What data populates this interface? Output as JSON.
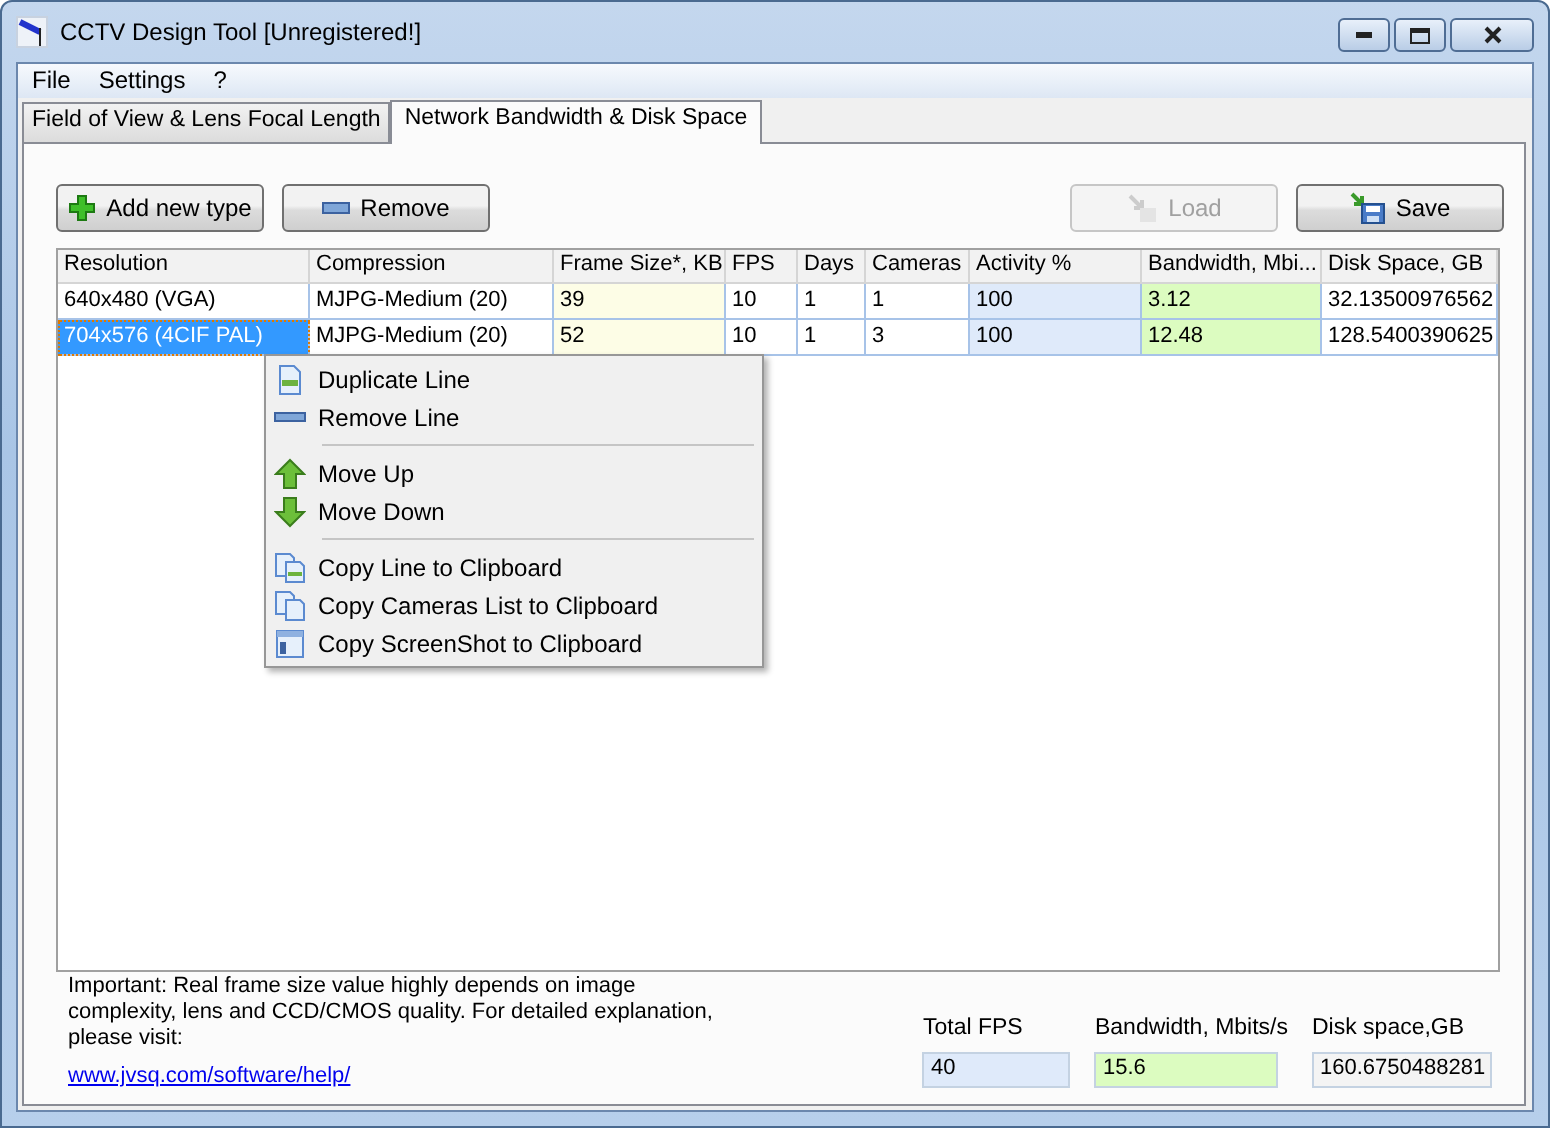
{
  "window": {
    "title": "CCTV Design Tool [Unregistered!]"
  },
  "menu": [
    "File",
    "Settings",
    "?"
  ],
  "tabs": [
    {
      "label": "Field of View & Lens Focal Length",
      "selected": false
    },
    {
      "label": "Network Bandwidth & Disk Space",
      "selected": true
    }
  ],
  "toolbar": [
    {
      "label": "Add new type",
      "disabled": false
    },
    {
      "label": "Remove",
      "disabled": false
    },
    {
      "label": "Load",
      "disabled": true
    },
    {
      "label": "Save",
      "disabled": false
    }
  ],
  "table": {
    "columns": [
      {
        "label": "Resolution"
      },
      {
        "label": "Compression"
      },
      {
        "label": "Frame Size*, KB",
        "color": "#fdfde6"
      },
      {
        "label": "FPS"
      },
      {
        "label": "Days"
      },
      {
        "label": "Cameras"
      },
      {
        "label": "Activity %",
        "color": "#dfeafa"
      },
      {
        "label": "Bandwidth, Mbi...",
        "color": "#dcfcc0"
      },
      {
        "label": "Disk Space, GB"
      }
    ],
    "rows": [
      {
        "selected": false,
        "cells": [
          "640x480 (VGA)",
          "MJPG-Medium (20)",
          "39",
          "10",
          "1",
          "1",
          "100",
          "3.12",
          "32.13500976562"
        ]
      },
      {
        "selected": true,
        "cells": [
          "704x576 (4CIF PAL)",
          "MJPG-Medium (20)",
          "52",
          "10",
          "1",
          "3",
          "100",
          "12.48",
          "128.5400390625"
        ]
      }
    ]
  },
  "context_menu": {
    "groups": [
      [
        "Duplicate Line",
        "Remove Line"
      ],
      [
        "Move Up",
        "Move Down"
      ],
      [
        "Copy Line to Clipboard",
        "Copy Cameras List to Clipboard",
        "Copy ScreenShot to Clipboard"
      ]
    ]
  },
  "note": {
    "text": "Important: Real frame size value highly depends on image complexity, lens and CCD/CMOS quality. For detailed explanation, please visit:",
    "link": "www.jvsq.com/software/help/"
  },
  "totals": [
    {
      "label": "Total FPS",
      "value": "40",
      "color": "#dfeafa"
    },
    {
      "label": "Bandwidth, Mbits/s",
      "value": "15.6",
      "color": "#dcfcc0"
    },
    {
      "label": "Disk space,GB",
      "value": "160.6750488281",
      "color": "#f4f4f4"
    }
  ]
}
